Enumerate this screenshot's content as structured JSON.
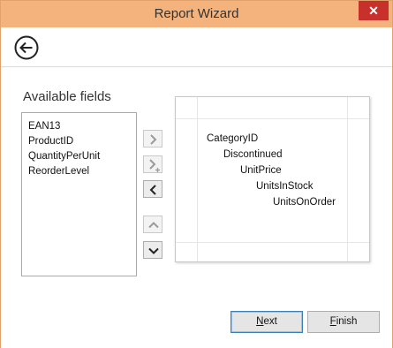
{
  "window": {
    "title": "Report Wizard",
    "close_glyph": "✕"
  },
  "header": {
    "back_icon": "back-arrow-icon"
  },
  "available": {
    "label": "Available fields",
    "fields": [
      "EAN13",
      "ProductID",
      "QuantityPerUnit",
      "ReorderLevel"
    ]
  },
  "mover_buttons": [
    {
      "name": "add-field-button",
      "icon": "chevron-right-icon",
      "enabled": false
    },
    {
      "name": "add-field-with-plus-button",
      "icon": "chevron-right-plus-icon",
      "enabled": false
    },
    {
      "name": "remove-field-button",
      "icon": "chevron-left-icon",
      "enabled": true
    },
    {
      "name": "move-up-button",
      "icon": "chevron-up-icon",
      "enabled": false
    },
    {
      "name": "move-down-button",
      "icon": "chevron-down-icon",
      "enabled": true
    }
  ],
  "grouping": {
    "levels": [
      "CategoryID",
      "Discontinued",
      "UnitPrice",
      "UnitsInStock",
      "UnitsOnOrder"
    ]
  },
  "footer": {
    "next_label_hotkey": "N",
    "next_label_rest": "ext",
    "finish_label_hotkey": "F",
    "finish_label_rest": "inish"
  },
  "colors": {
    "titlebar": "#f4b27c",
    "close": "#c7302b",
    "default_button_border": "#3c7fb1"
  }
}
